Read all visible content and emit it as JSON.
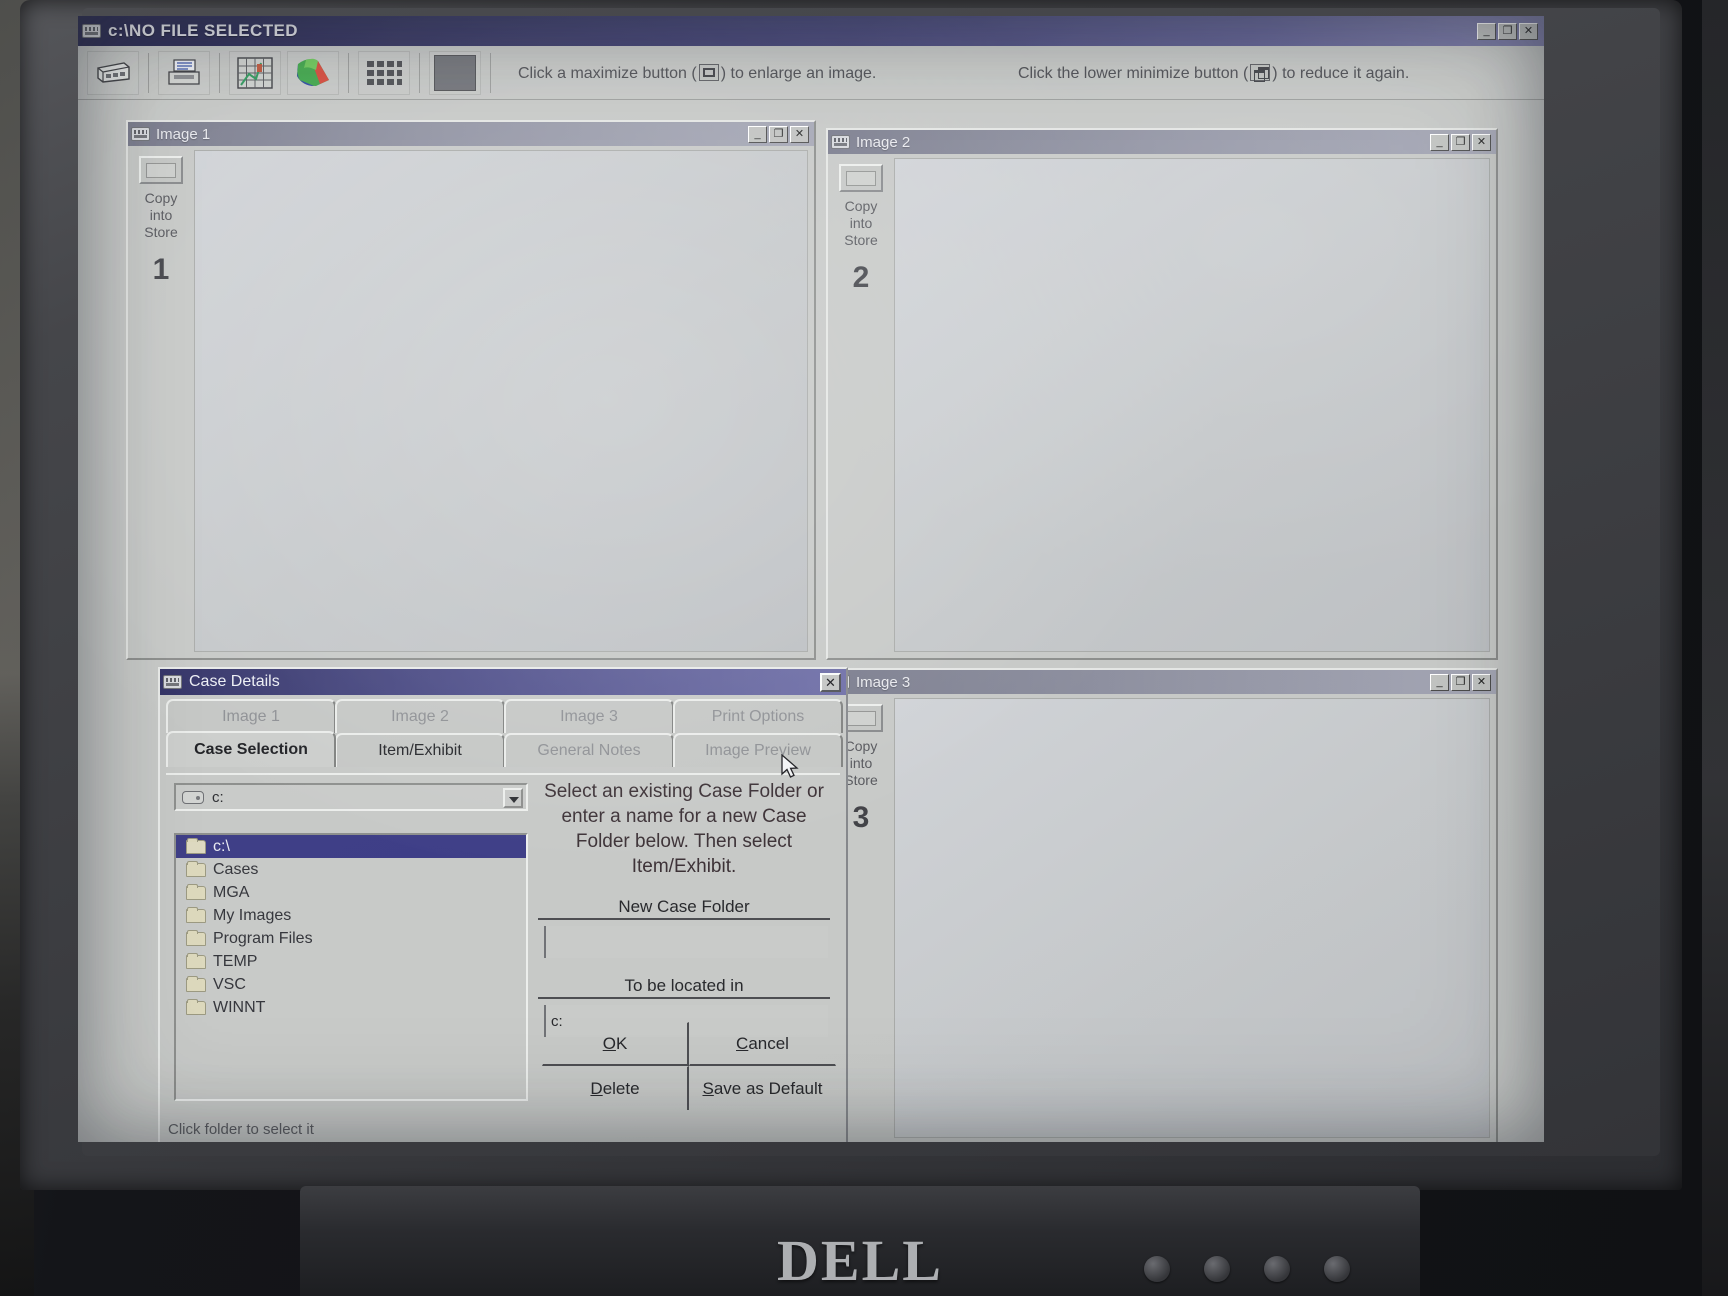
{
  "monitor": {
    "brand": "DELL"
  },
  "app": {
    "title": "c:\\NO FILE SELECTED",
    "title_icon": "app-window-icon",
    "sys_buttons": {
      "minimize": "_",
      "restore": "❐",
      "close": "✕"
    },
    "toolbar": {
      "buttons": [
        {
          "name": "scanner-icon",
          "label": "Scanner"
        },
        {
          "name": "printer-icon",
          "label": "Print"
        },
        {
          "name": "grid-chart-icon",
          "label": "Measure Grid"
        },
        {
          "name": "color-palette-icon",
          "label": "Colour"
        },
        {
          "name": "thumbnail-grid-icon",
          "label": "Thumbnails"
        },
        {
          "name": "dark-square-icon",
          "label": "Image Store"
        }
      ],
      "hint_left": "Click a maximize button (",
      "hint_left_end": ") to enlarge an image.",
      "hint_right": "Click the lower minimize button (",
      "hint_right_end": ") to reduce it again."
    }
  },
  "image_windows": [
    {
      "title": "Image 1",
      "copy_line1": "Copy",
      "copy_line2": "into",
      "copy_line3": "Store",
      "number": "1",
      "sys": {
        "minimize": "_",
        "restore": "❐",
        "close": "✕"
      }
    },
    {
      "title": "Image 2",
      "copy_line1": "Copy",
      "copy_line2": "into",
      "copy_line3": "Store",
      "number": "2",
      "sys": {
        "minimize": "_",
        "restore": "❐",
        "close": "✕"
      }
    },
    {
      "title": "Image 3",
      "copy_line1": "Copy",
      "copy_line2": "into",
      "copy_line3": "Store",
      "number": "3",
      "sys": {
        "minimize": "_",
        "restore": "❐",
        "close": "✕"
      }
    }
  ],
  "case_dialog": {
    "title": "Case Details",
    "close_label": "✕",
    "tabs_row1": [
      {
        "label": "Image 1",
        "state": "disabled"
      },
      {
        "label": "Image 2",
        "state": "disabled"
      },
      {
        "label": "Image 3",
        "state": "disabled"
      },
      {
        "label": "Print Options",
        "state": "disabled"
      }
    ],
    "tabs_row2": [
      {
        "label": "Case Selection",
        "state": "active"
      },
      {
        "label": "Item/Exhibit",
        "state": "enabled"
      },
      {
        "label": "General Notes",
        "state": "disabled"
      },
      {
        "label": "Image Preview",
        "state": "disabled"
      }
    ],
    "drive_combo": {
      "value": "c:",
      "icon": "drive-icon"
    },
    "folder_tree": [
      {
        "label": "c:\\",
        "selected": true,
        "icon": "folder-open-icon"
      },
      {
        "label": "Cases",
        "selected": false,
        "icon": "folder-icon"
      },
      {
        "label": "MGA",
        "selected": false,
        "icon": "folder-icon"
      },
      {
        "label": "My Images",
        "selected": false,
        "icon": "folder-icon"
      },
      {
        "label": "Program Files",
        "selected": false,
        "icon": "folder-icon"
      },
      {
        "label": "TEMP",
        "selected": false,
        "icon": "folder-icon"
      },
      {
        "label": "VSC",
        "selected": false,
        "icon": "folder-icon"
      },
      {
        "label": "WINNT",
        "selected": false,
        "icon": "folder-icon"
      }
    ],
    "status_hint": "Click folder to select it",
    "instruction": "Select an existing Case Folder or enter a name for a new Case Folder below. Then select Item/Exhibit.",
    "new_case_folder": {
      "label": "New Case Folder",
      "value": ""
    },
    "to_be_located_in": {
      "label": "To be located in",
      "value": "c:"
    },
    "buttons": [
      {
        "label": "OK",
        "accel": "O"
      },
      {
        "label": "Cancel",
        "accel": "C"
      },
      {
        "label": "Delete",
        "accel": "D"
      },
      {
        "label": "Save as Default",
        "accel": "S"
      }
    ]
  },
  "colors": {
    "title_blue": "#3a3a6e",
    "selection_blue": "#3b3b85",
    "face_gray": "#c6c8c6",
    "child_title_gray": "#8e90a0"
  }
}
